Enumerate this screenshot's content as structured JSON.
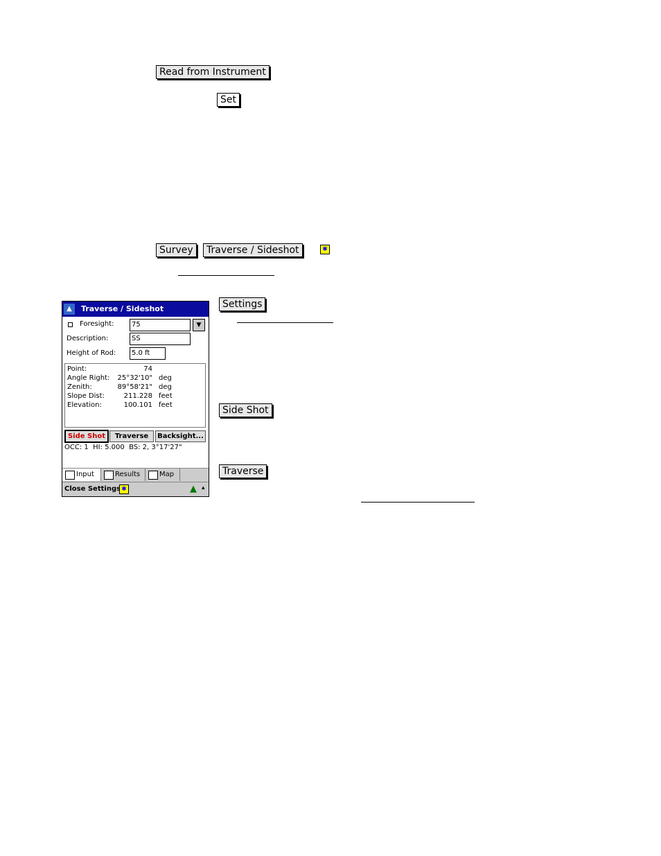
{
  "doc_buttons": {
    "read_from_instrument": "Read from Instrument",
    "set": "Set",
    "survey": "Survey",
    "traverse_sideshot": "Traverse / Sideshot",
    "settings": "Settings",
    "side_shot": "Side Shot",
    "traverse": "Traverse"
  },
  "device": {
    "title": "Traverse / Sideshot",
    "foresight_label": "Foresight:",
    "foresight_value": "75",
    "description_label": "Description:",
    "description_value": "SS",
    "rod_label": "Height of Rod:",
    "rod_value": "5.0 ft",
    "results": [
      {
        "label": "Point:",
        "value": "74",
        "unit": ""
      },
      {
        "label": "Angle Right:",
        "value": "25°32'10\"",
        "unit": "deg"
      },
      {
        "label": "Zenith:",
        "value": "89°58'21\"",
        "unit": "deg"
      },
      {
        "label": "Slope Dist:",
        "value": "211.228",
        "unit": "feet"
      },
      {
        "label": "Elevation:",
        "value": "100.101",
        "unit": "feet"
      }
    ],
    "buttons": {
      "side_shot": "Side Shot",
      "traverse": "Traverse",
      "backsight": "Backsight..."
    },
    "status": "OCC: 1  HI: 5.000  BS: 2, 3°17'27\"",
    "tabs": [
      "Input",
      "Results",
      "Map"
    ],
    "bottom_bar": "Close Settings"
  }
}
